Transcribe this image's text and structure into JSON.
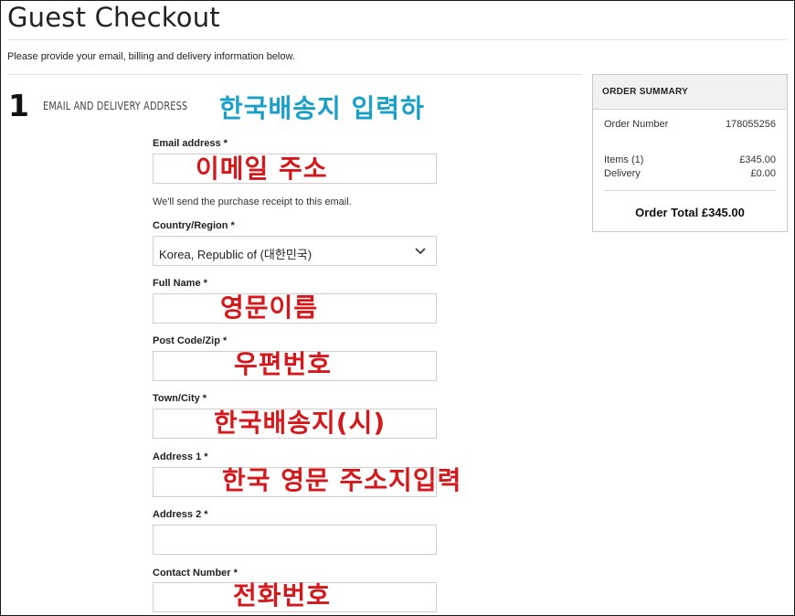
{
  "page": {
    "title": "Guest Checkout",
    "intro": "Please provide your email, billing and delivery information below."
  },
  "step": {
    "number": "1",
    "title": "EMAIL AND DELIVERY ADDRESS",
    "annotation": "한국배송지 입력하"
  },
  "form": {
    "email": {
      "label": "Email address *",
      "value": "",
      "annotation": "이메일 주소",
      "help": "We'll send the purchase receipt to this email."
    },
    "country": {
      "label": "Country/Region *",
      "selected": "Korea, Republic of (대한민국)"
    },
    "full_name": {
      "label": "Full Name *",
      "value": "",
      "annotation": "영문이름"
    },
    "post_code": {
      "label": "Post Code/Zip *",
      "value": "",
      "annotation": "우편번호"
    },
    "town": {
      "label": "Town/City *",
      "value": "",
      "annotation": "한국배송지(시)"
    },
    "address1": {
      "label": "Address 1 *",
      "value": "",
      "annotation": "한국 영문 주소지입력"
    },
    "address2": {
      "label": "Address 2 *",
      "value": ""
    },
    "contact": {
      "label": "Contact Number *",
      "value": "",
      "annotation": "전화번호"
    }
  },
  "summary": {
    "title": "ORDER SUMMARY",
    "order_number_label": "Order Number",
    "order_number": "178055256",
    "items_label": "Items (1)",
    "items_value": "£345.00",
    "delivery_label": "Delivery",
    "delivery_value": "£0.00",
    "total_text": "Order Total £345.00"
  },
  "colors": {
    "annotation_red": "#d4181b",
    "annotation_blue": "#1aa0c8"
  },
  "icons": {
    "country_dropdown": "chevron-down-icon"
  }
}
